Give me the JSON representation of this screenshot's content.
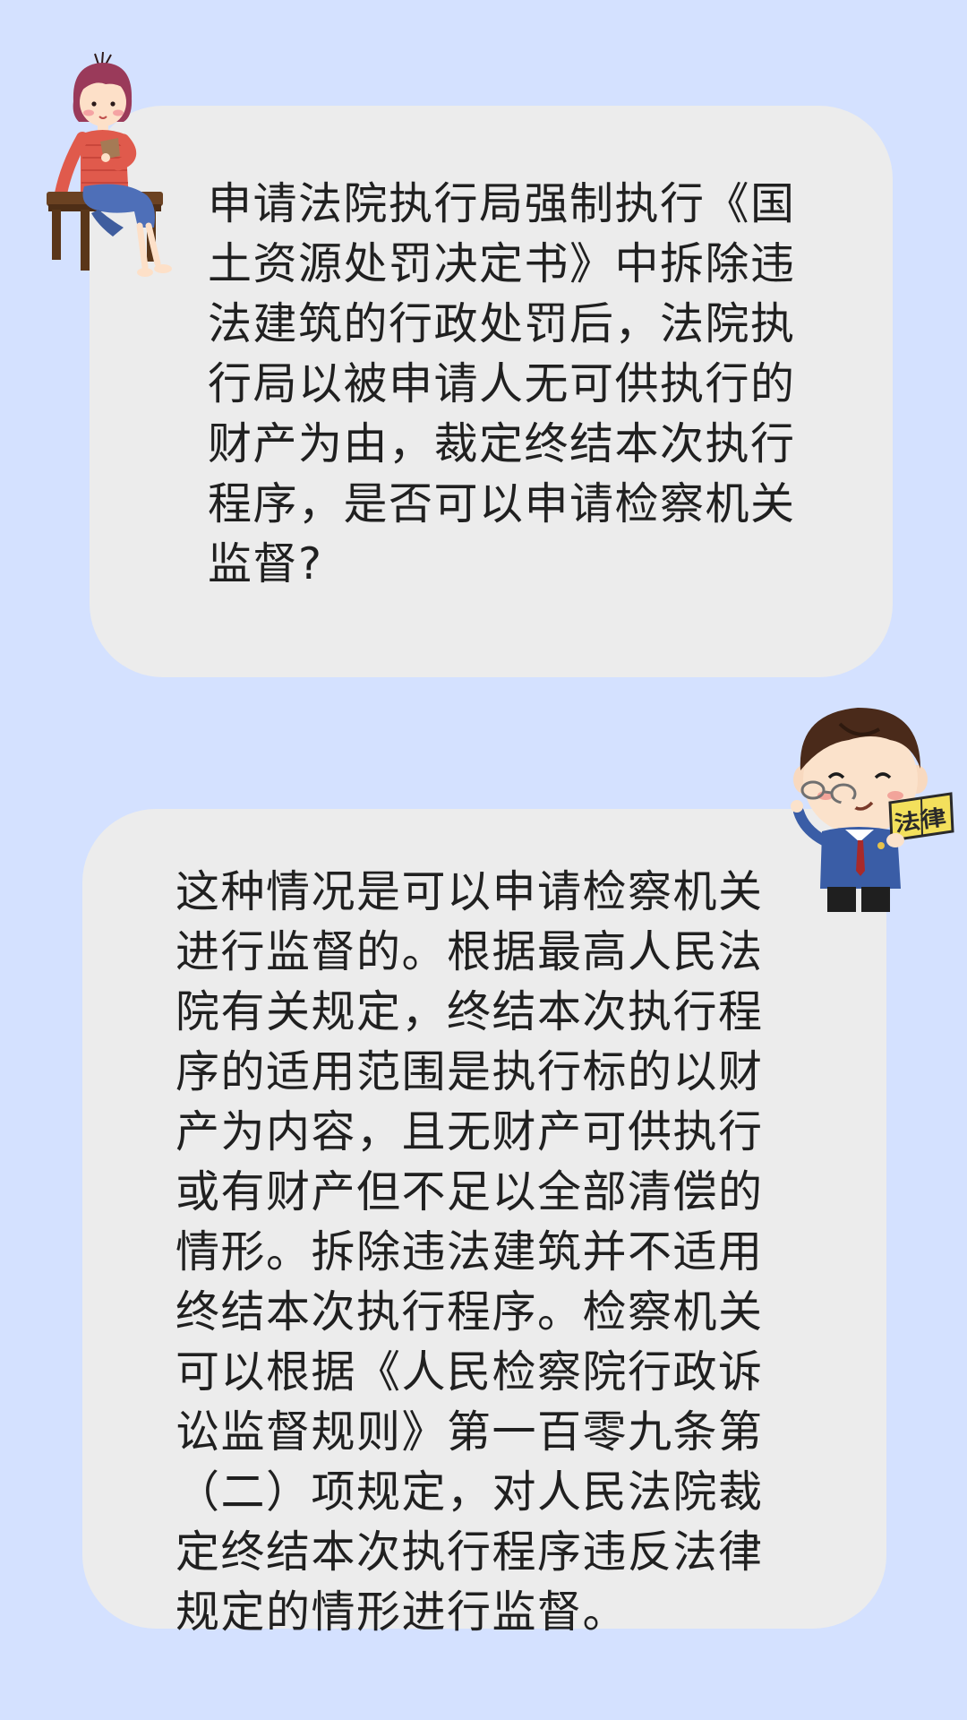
{
  "question": {
    "lines": [
      "申请法院执行局强制执行《国",
      "土资源处罚决定书》中拆除违",
      "法建筑的行政处罚后，法院执",
      "行局以被申请人无可供执行的",
      "财产为由，裁定终结本次执行",
      "程序，是否可以申请检察机关",
      "监督?"
    ]
  },
  "answer": {
    "lines": [
      "这种情况是可以申请检察机关",
      "进行监督的。根据最高人民法",
      "院有关规定，终结本次执行程",
      "序的适用范围是执行标的以财",
      "产为内容，且无财产可供执行",
      "或有财产但不足以全部清偿的",
      "情形。拆除违法建筑并不适用",
      "终结本次执行程序。检察机关",
      "可以根据《人民检察院行政诉",
      "讼监督规则》第一百零九条第",
      "（二）项规定，对人民法院裁",
      "定终结本次执行程序违反法律",
      "规定的情形进行监督。"
    ]
  },
  "illustrations": {
    "girl": {
      "icon": "girl-sitting-on-bench-icon"
    },
    "lawyer": {
      "icon": "prosecutor-holding-law-book-icon",
      "book_text": "法律"
    }
  },
  "colors": {
    "background": "#d4e1ff",
    "bubble": "#ececec",
    "text": "#202020"
  }
}
